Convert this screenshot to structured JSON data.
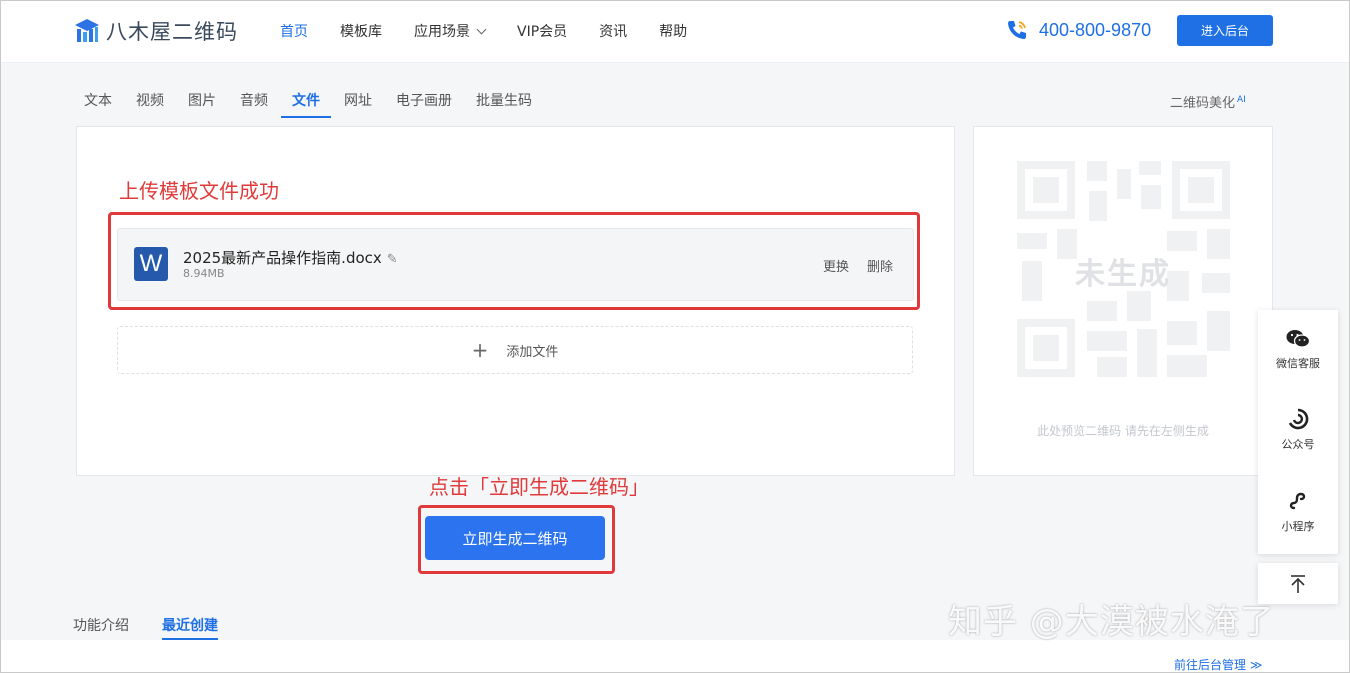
{
  "header": {
    "logo_text": "八木屋二维码",
    "nav": [
      {
        "label": "首页",
        "active": true
      },
      {
        "label": "模板库"
      },
      {
        "label": "应用场景",
        "dropdown": true
      },
      {
        "label": "VIP会员"
      },
      {
        "label": "资讯"
      },
      {
        "label": "帮助"
      }
    ],
    "phone": "400-800-9870",
    "admin_button": "进入后台"
  },
  "tabs": {
    "items": [
      "文本",
      "视频",
      "图片",
      "音频",
      "文件",
      "网址",
      "电子画册",
      "批量生码"
    ],
    "active_index": 4,
    "beautify_label": "二维码美化",
    "beautify_badge": "AI"
  },
  "annotations": {
    "upload_success": "上传模板文件成功",
    "click_generate": "点击「立即生成二维码」"
  },
  "file": {
    "icon_letter": "W",
    "name": "2025最新产品操作指南.docx",
    "size": "8.94MB",
    "replace_label": "更换",
    "delete_label": "删除"
  },
  "add_file_label": "添加文件",
  "generate_button": "立即生成二维码",
  "preview": {
    "placeholder": "未生成",
    "hint": "此处预览二维码 请先在左侧生成"
  },
  "side_widget": {
    "items": [
      "微信客服",
      "公众号",
      "小程序"
    ]
  },
  "bottom": {
    "tabs": [
      {
        "label": "功能介绍"
      },
      {
        "label": "最近创建",
        "active": true
      }
    ],
    "goto_admin": "前往后台管理 ≫"
  },
  "watermark": "知乎 @大漠被水淹了",
  "colors": {
    "accent": "#1f6fe5",
    "button": "#2b73ef",
    "annotation_red": "#e0393c",
    "word_blue": "#2459ac"
  }
}
